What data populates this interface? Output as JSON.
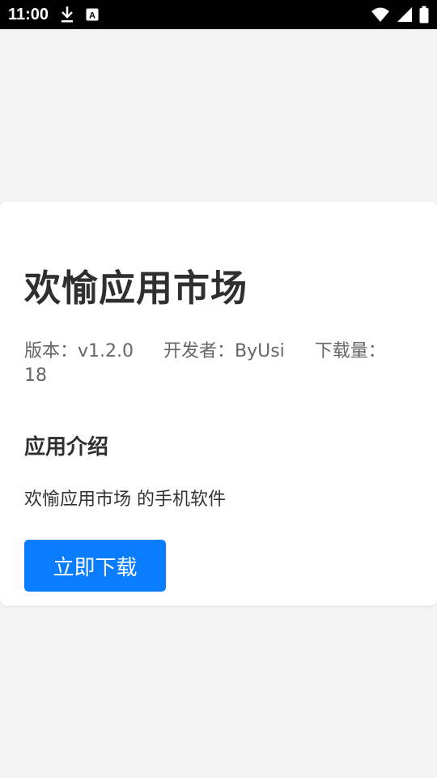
{
  "status_bar": {
    "time": "11:00",
    "icons": [
      "download-icon",
      "a-badge-icon",
      "wifi-icon",
      "signal-icon",
      "battery-icon"
    ],
    "badge_letter": "A"
  },
  "app": {
    "title": "欢愉应用市场",
    "meta": {
      "version": "版本：v1.2.0",
      "developer": "开发者：ByUsi",
      "downloads": "下载量：18"
    },
    "section_title": "应用介绍",
    "description": "欢愉应用市场 的手机软件",
    "download_label": "立即下载"
  },
  "colors": {
    "background": "#f4f4f4",
    "card": "#ffffff",
    "accent": "#0a7cff",
    "title": "#2f2f2f",
    "meta": "#666666"
  }
}
